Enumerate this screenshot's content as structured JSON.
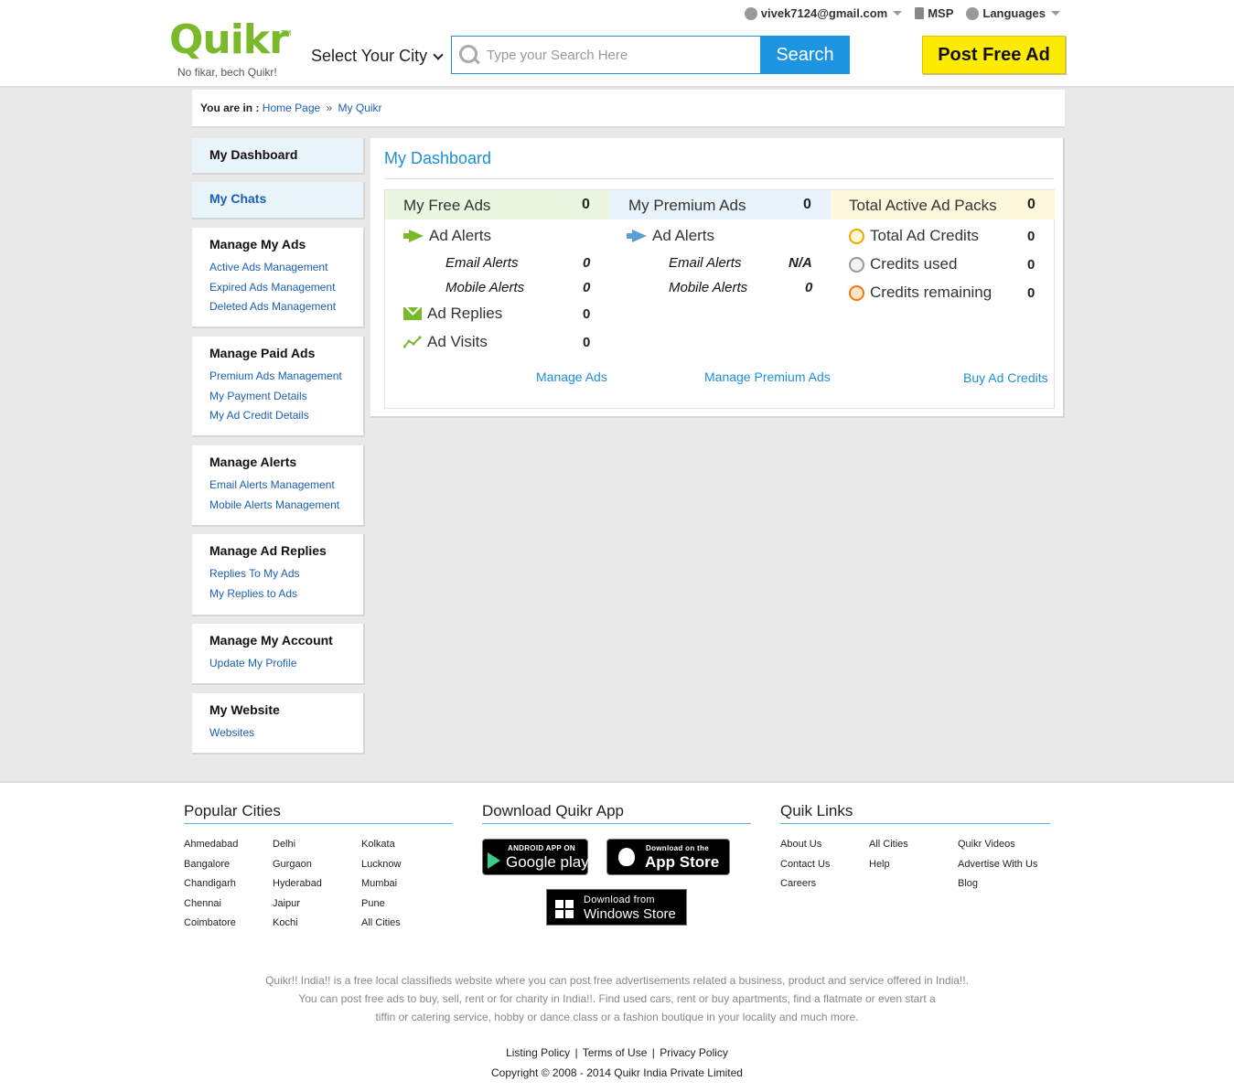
{
  "header": {
    "logo_text": "Quikr",
    "logo_tm": "TM",
    "logo_tagline": "No fikar, bech Quikr!",
    "user_email": "vivek7124@gmail.com",
    "msp_label": "MSP",
    "languages_label": "Languages",
    "city_select_label": "Select Your City",
    "search_placeholder": "Type your Search Here",
    "search_button": "Search",
    "post_ad_button": "Post Free Ad"
  },
  "breadcrumb": {
    "prefix": "You are in :",
    "home": "Home Page",
    "separator": "»",
    "current": "My Quikr"
  },
  "sidebar": {
    "dashboard": "My Dashboard",
    "chats": "My Chats",
    "sections": [
      {
        "title": "Manage My Ads",
        "links": [
          "Active Ads Management",
          "Expired Ads Management",
          "Deleted Ads Management"
        ]
      },
      {
        "title": "Manage Paid Ads",
        "links": [
          "Premium Ads Management",
          "My Payment Details",
          "My Ad Credit Details"
        ]
      },
      {
        "title": "Manage Alerts",
        "links": [
          "Email Alerts Management",
          "Mobile Alerts Management"
        ]
      },
      {
        "title": "Manage Ad Replies",
        "links": [
          "Replies To My Ads",
          "My Replies to Ads"
        ]
      },
      {
        "title": "Manage My Account",
        "links": [
          "Update My Profile"
        ]
      },
      {
        "title": "My Website",
        "links": [
          "Websites"
        ]
      }
    ]
  },
  "dashboard": {
    "title": "My Dashboard",
    "free": {
      "heading": "My Free Ads",
      "heading_value": "0",
      "ad_alerts": "Ad Alerts",
      "email_alerts": "Email Alerts",
      "email_alerts_value": "0",
      "mobile_alerts": "Mobile Alerts",
      "mobile_alerts_value": "0",
      "ad_replies": "Ad Replies",
      "ad_replies_value": "0",
      "ad_visits": "Ad Visits",
      "ad_visits_value": "0",
      "link": "Manage Ads"
    },
    "premium": {
      "heading": "My Premium Ads",
      "heading_value": "0",
      "ad_alerts": "Ad Alerts",
      "email_alerts": "Email Alerts",
      "email_alerts_value": "N/A",
      "mobile_alerts": "Mobile Alerts",
      "mobile_alerts_value": "0",
      "link": "Manage Premium Ads"
    },
    "packs": {
      "heading": "Total Active Ad Packs",
      "heading_value": "0",
      "total_credits": "Total Ad Credits",
      "total_credits_value": "0",
      "credits_used": "Credits used",
      "credits_used_value": "0",
      "credits_remaining": "Credits remaining",
      "credits_remaining_value": "0",
      "link": "Buy Ad Credits"
    }
  },
  "footer": {
    "popular_cities_title": "Popular Cities",
    "cities": [
      [
        "Ahmedabad",
        "Delhi",
        "Kolkata"
      ],
      [
        "Bangalore",
        "Gurgaon",
        "Lucknow"
      ],
      [
        "Chandigarh",
        "Hyderabad",
        "Mumbai"
      ],
      [
        "Chennai",
        "Jaipur",
        "Pune"
      ],
      [
        "Coimbatore",
        "Kochi",
        "All Cities"
      ]
    ],
    "download_title": "Download Quikr App",
    "google_play_small": "ANDROID APP ON",
    "google_play_big": "Google play",
    "app_store_small": "Download on the",
    "app_store_big": "App Store",
    "windows_small": "Download from",
    "windows_big": "Windows Store",
    "quik_links_title": "Quik Links",
    "quik_links": [
      [
        "About Us",
        "All Cities",
        "Quikr Videos"
      ],
      [
        "Contact Us",
        "Help",
        "Advertise With Us"
      ],
      [
        "Careers",
        "",
        "Blog"
      ]
    ],
    "about_lines": [
      "Quikr!! India!! is a free local classifieds website where you can post free advertisements related a business, product and service offered in India!!.",
      "You can post free ads to buy, sell, rent or for charity in India!!. Find used cars, rent or buy apartments, find a flatmate or even start a",
      "tiffin or catering service, hobby or dance class or a fashion boutique in your locality and much more."
    ],
    "listing_policy": "Listing Policy",
    "terms": "Terms of Use",
    "privacy": "Privacy Policy",
    "legal_separator": "|",
    "copyright": "Copyright © 2008 - 2014 Quikr India Private Limited"
  },
  "colors": {
    "brand_green": "#7ab929",
    "search_blue": "#1c94e0",
    "post_ad_yellow": "#ffeb00",
    "link_blue": "#1a5fb4",
    "free_ads_bg": "#eaf6e0",
    "premium_ads_bg": "#e8f3fb",
    "packs_bg": "#fbf8dc"
  }
}
